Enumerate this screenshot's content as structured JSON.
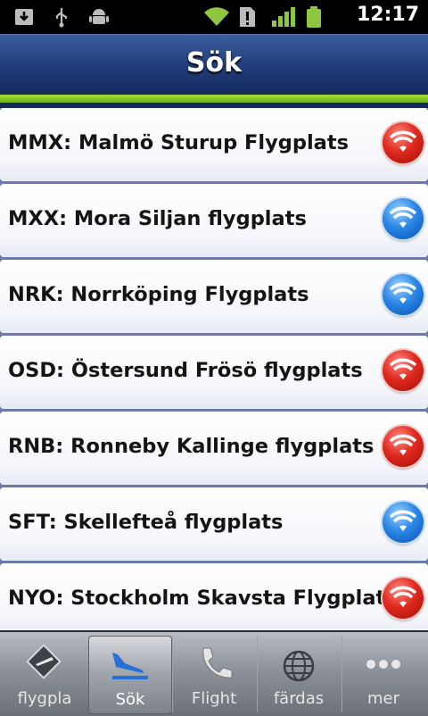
{
  "status_bar": {
    "time": "12:17",
    "icons": [
      "download-icon",
      "usb-icon",
      "android-icon",
      "wifi-signal-icon",
      "alert-icon",
      "cell-signal-icon",
      "battery-icon"
    ]
  },
  "header": {
    "title": "Sök"
  },
  "airports": [
    {
      "label": "MMX: Malmö Sturup Flygplats",
      "status": "red"
    },
    {
      "label": "MXX: Mora Siljan flygplats",
      "status": "blue"
    },
    {
      "label": "NRK: Norrköping Flygplats",
      "status": "blue"
    },
    {
      "label": "OSD: Östersund Frösö flygplats",
      "status": "red"
    },
    {
      "label": "RNB: Ronneby Kallinge flygplats",
      "status": "red"
    },
    {
      "label": "SFT: Skellefteå flygplats",
      "status": "blue"
    },
    {
      "label": "NYO: Stockholm Skavsta Flygplats",
      "status": "red"
    }
  ],
  "tabs": [
    {
      "label": "flygpla",
      "icon": "airport-sign-icon",
      "active": false
    },
    {
      "label": "Sök",
      "icon": "plane-landing-icon",
      "active": true
    },
    {
      "label": "Flight",
      "icon": "phone-icon",
      "active": false
    },
    {
      "label": "färdas",
      "icon": "globe-icon",
      "active": false
    },
    {
      "label": "mer",
      "icon": "more-dots-icon",
      "active": false
    }
  ],
  "colors": {
    "header": "#223e7c",
    "accent_green": "#8cc928",
    "status_red": "#e02a1f",
    "status_blue": "#2a88e6"
  }
}
